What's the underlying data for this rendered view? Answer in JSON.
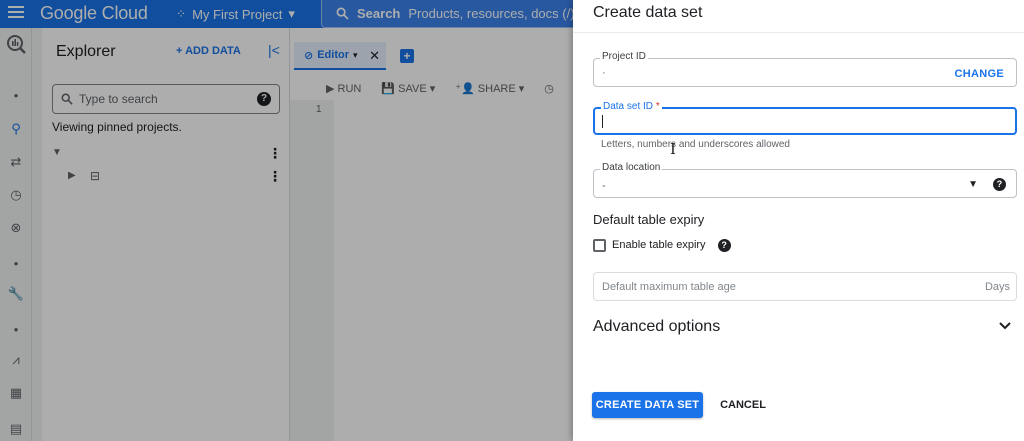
{
  "topbar": {
    "brand": "Google Cloud",
    "project": "My First Project",
    "search_label": "Search",
    "search_placeholder": "Products, resources, docs (/)"
  },
  "explorer": {
    "title": "Explorer",
    "add_data": "+ ADD DATA",
    "search_placeholder": "Type to search",
    "pinned_text": "Viewing pinned projects."
  },
  "editor": {
    "tab_label": "Editor",
    "toolbar": {
      "run": "RUN",
      "save": "SAVE",
      "share": "SHARE"
    },
    "line_number": "1"
  },
  "panel": {
    "title": "Create data set",
    "project_id": {
      "label": "Project ID",
      "change": "CHANGE"
    },
    "dataset_id": {
      "label": "Data set ID",
      "required_mark": "*",
      "value": "",
      "hint": "Letters, numbers and underscores allowed"
    },
    "data_location": {
      "label": "Data location"
    },
    "table_expiry": {
      "title": "Default table expiry",
      "checkbox_label": "Enable table expiry",
      "checked": false,
      "age_placeholder": "Default maximum table age",
      "age_unit": "Days"
    },
    "advanced": "Advanced options",
    "create_button": "CREATE DATA SET",
    "cancel_button": "CANCEL"
  },
  "colors": {
    "primary": "#1a73e8",
    "required": "#d93025"
  }
}
